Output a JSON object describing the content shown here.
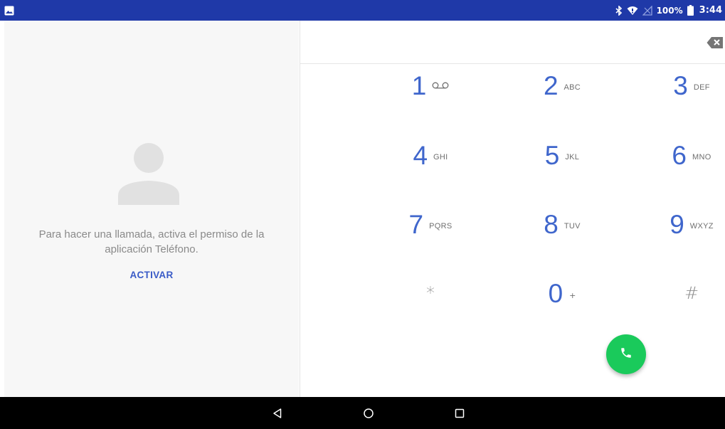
{
  "status_bar": {
    "left_icon": "image-icon",
    "battery_percent": "100%",
    "time": "3:44",
    "icons": [
      "bluetooth-icon",
      "wifi-icon",
      "no-signal-icon",
      "battery-icon"
    ],
    "background": "#1f39a8"
  },
  "left_pane": {
    "avatar_icon": "person-icon",
    "message_line1": "Para hacer una llamada, activa el permiso de la",
    "message_line2": "aplicación Teléfono.",
    "activate_label": "ACTIVAR"
  },
  "dialer": {
    "digits_value": "",
    "backspace_icon": "backspace-icon",
    "keys": [
      {
        "digit": "1",
        "letters": "",
        "icon": "voicemail-icon"
      },
      {
        "digit": "2",
        "letters": "ABC"
      },
      {
        "digit": "3",
        "letters": "DEF"
      },
      {
        "digit": "4",
        "letters": "GHI"
      },
      {
        "digit": "5",
        "letters": "JKL"
      },
      {
        "digit": "6",
        "letters": "MNO"
      },
      {
        "digit": "7",
        "letters": "PQRS"
      },
      {
        "digit": "8",
        "letters": "TUV"
      },
      {
        "digit": "9",
        "letters": "WXYZ"
      },
      {
        "digit": "*",
        "letters": ""
      },
      {
        "digit": "0",
        "letters": "+"
      },
      {
        "digit": "#",
        "letters": ""
      }
    ],
    "call_button_color": "#1aca5b",
    "accent_color": "#3f66cc"
  },
  "nav_bar": {
    "back_icon": "back-icon",
    "home_icon": "home-icon",
    "recents_icon": "recents-icon"
  }
}
